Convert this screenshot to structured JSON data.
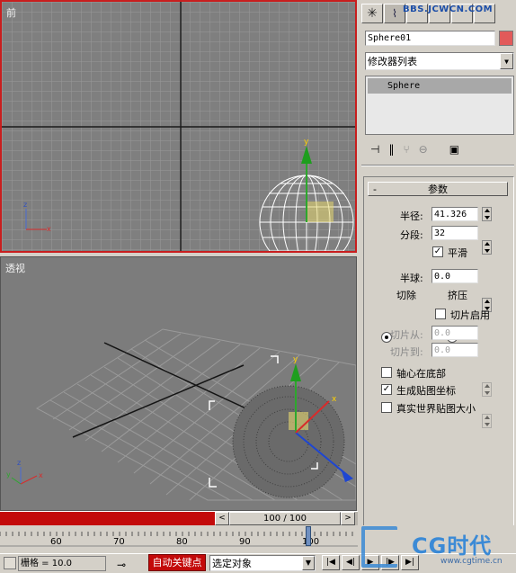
{
  "watermark_top": "BBS.JCWCN.COM",
  "viewports": {
    "front_label": "前",
    "perspective_label": "透视"
  },
  "panel": {
    "object_name": "Sphere01",
    "object_color": "#e25a5a",
    "modifier_list": "修改器列表",
    "stack_item": "Sphere",
    "rollout_title": "参数",
    "radius_label": "半径:",
    "radius_value": "41.326",
    "segments_label": "分段:",
    "segments_value": "32",
    "smooth_label": "平滑",
    "smooth_checked": "✓",
    "hemisphere_label": "半球:",
    "hemisphere_value": "0.0",
    "chop_label": "切除",
    "squash_label": "挤压",
    "slice_on_label": "切片启用",
    "slice_from_label": "切片从:",
    "slice_from_value": "0.0",
    "slice_to_label": "切片到:",
    "slice_to_value": "0.0",
    "base_to_pivot_label": "轴心在底部",
    "gen_mapping_label": "生成贴图坐标",
    "gen_mapping_checked": "✓",
    "real_world_label": "真实世界贴图大小"
  },
  "timeline": {
    "frame_display": "100 / 100",
    "ticks": [
      "60",
      "70",
      "80",
      "90",
      "100"
    ]
  },
  "status": {
    "grid_text": "栅格 = 10.0",
    "autokey_label": "自动关键点",
    "selection_filter": "选定对象"
  },
  "logo_text": "CG时代",
  "logo_sub": "www.cgtime.cn"
}
